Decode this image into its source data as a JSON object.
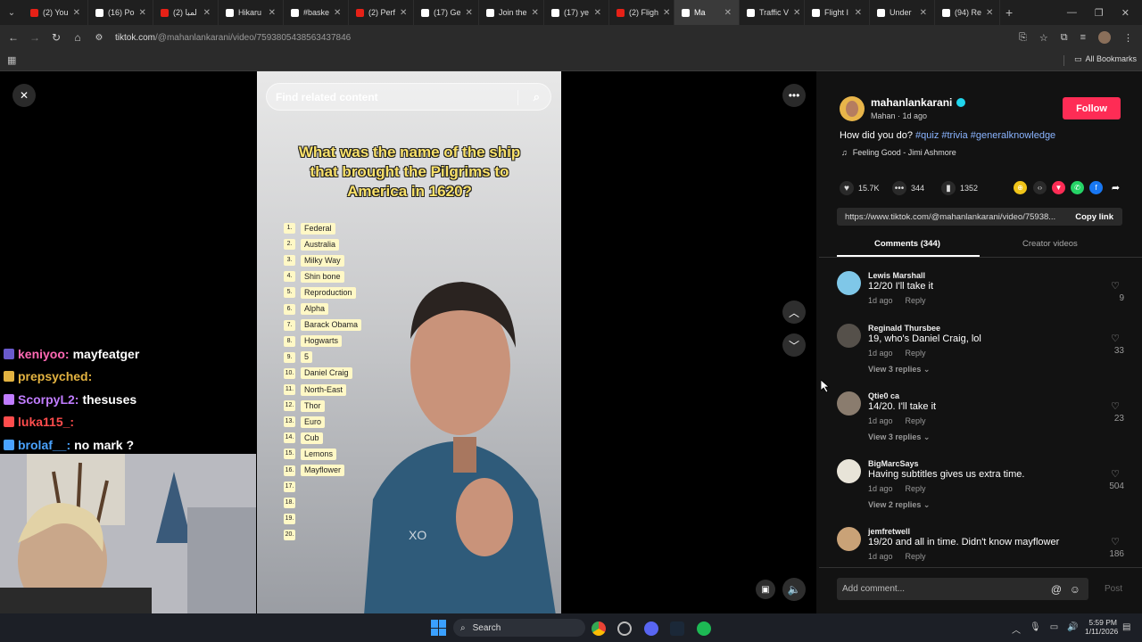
{
  "browser": {
    "tabs": [
      {
        "label": "(2) You",
        "color": "#e62117"
      },
      {
        "label": "(16) Po",
        "color": "#ffffff"
      },
      {
        "label": "لمبا (2)",
        "color": "#e62117"
      },
      {
        "label": "Hikaru",
        "color": "#ffffff"
      },
      {
        "label": "#baske",
        "color": "#ffffff"
      },
      {
        "label": "(2) Perf",
        "color": "#e62117"
      },
      {
        "label": "(17) Ge",
        "color": "#ffffff"
      },
      {
        "label": "Join the",
        "color": "#ffffff"
      },
      {
        "label": "(17) ye",
        "color": "#ffffff"
      },
      {
        "label": "(2) Fligh",
        "color": "#e62117"
      },
      {
        "label": "Ma",
        "color": "#ffffff",
        "active": true
      },
      {
        "label": "Traffic V",
        "color": "#ffffff"
      },
      {
        "label": "Flight I",
        "color": "#ffffff"
      },
      {
        "label": "Under",
        "color": "#ffffff"
      },
      {
        "label": "(94) Re",
        "color": "#ffffff"
      }
    ],
    "url_domain": "tiktok.com",
    "url_path": "/@mahanlankarani/video/7593805438563437846",
    "bookmarks_label": "All Bookmarks"
  },
  "player": {
    "search_placeholder": "Find related content",
    "question": "What was the name of the ship that brought the Pilgrims to America in 1620?",
    "answers": [
      {
        "n": "1.",
        "a": "Federal"
      },
      {
        "n": "2.",
        "a": "Australia"
      },
      {
        "n": "3.",
        "a": "Milky Way"
      },
      {
        "n": "4.",
        "a": "Shin bone"
      },
      {
        "n": "5.",
        "a": "Reproduction"
      },
      {
        "n": "6.",
        "a": "Alpha"
      },
      {
        "n": "7.",
        "a": "Barack Obama"
      },
      {
        "n": "8.",
        "a": "Hogwarts"
      },
      {
        "n": "9.",
        "a": "5"
      },
      {
        "n": "10.",
        "a": "Daniel Craig"
      },
      {
        "n": "11.",
        "a": "North-East"
      },
      {
        "n": "12.",
        "a": "Thor"
      },
      {
        "n": "13.",
        "a": "Euro"
      },
      {
        "n": "14.",
        "a": "Cub"
      },
      {
        "n": "15.",
        "a": "Lemons"
      },
      {
        "n": "16.",
        "a": "Mayflower"
      },
      {
        "n": "17.",
        "a": ""
      },
      {
        "n": "18.",
        "a": ""
      },
      {
        "n": "19.",
        "a": ""
      },
      {
        "n": "20.",
        "a": ""
      }
    ]
  },
  "stream_chat": [
    {
      "user": "keniyoo:",
      "user_color": "#ff69b4",
      "msg": "mayfeatger"
    },
    {
      "user": "prepsyched:",
      "user_color": "#e3b341",
      "msg": ""
    },
    {
      "user": "ScorpyL2:",
      "user_color": "#c07cff",
      "msg": "thesuses"
    },
    {
      "user": "luka115_:",
      "user_color": "#ff4d4d",
      "msg": ""
    },
    {
      "user": "brolaf__:",
      "user_color": "#4aa3ff",
      "msg": "no mark ?"
    }
  ],
  "creator": {
    "username": "mahanlankarani",
    "subline": "Mahan · 1d ago",
    "follow_label": "Follow",
    "caption": "How did you do?",
    "hashtags": "#quiz #trivia #generalknowledge",
    "music": "Feeling Good - Jimi Ashmore"
  },
  "stats": {
    "likes": "15.7K",
    "comments": "344",
    "saves": "1352"
  },
  "link": {
    "url": "https://www.tiktok.com/@mahanlankarani/video/75938...",
    "copy_label": "Copy link"
  },
  "tabs": {
    "comments": "Comments (344)",
    "creator_videos": "Creator videos"
  },
  "comments": [
    {
      "user": "Lewis Marshall",
      "text": "12/20 I'll take it",
      "time": "1d ago",
      "reply": "Reply",
      "likes": "9",
      "more": "",
      "avatar": "#7fc7e8"
    },
    {
      "user": "Reginald Thursbee",
      "text": "19, who's Daniel Craig, lol",
      "time": "1d ago",
      "reply": "Reply",
      "likes": "33",
      "more": "View 3 replies",
      "avatar": "#55504a"
    },
    {
      "user": "Qtie0 ca",
      "text": "14/20. I'll take it",
      "time": "1d ago",
      "reply": "Reply",
      "likes": "23",
      "more": "View 3 replies",
      "avatar": "#8a7c6e"
    },
    {
      "user": "BigMarcSays",
      "text": "Having subtitles gives us extra time.",
      "time": "1d ago",
      "reply": "Reply",
      "likes": "504",
      "more": "View 2 replies",
      "avatar": "#e8e4d8"
    },
    {
      "user": "jemfretwell",
      "text": "19/20 and all in time. Didn't know mayflower",
      "time": "1d ago",
      "reply": "Reply",
      "likes": "186",
      "more": "",
      "avatar": "#c9a277"
    }
  ],
  "compose": {
    "placeholder": "Add comment...",
    "post_label": "Post"
  },
  "taskbar": {
    "search_label": "Search",
    "time": "5:59 PM",
    "date": "1/11/2026"
  }
}
